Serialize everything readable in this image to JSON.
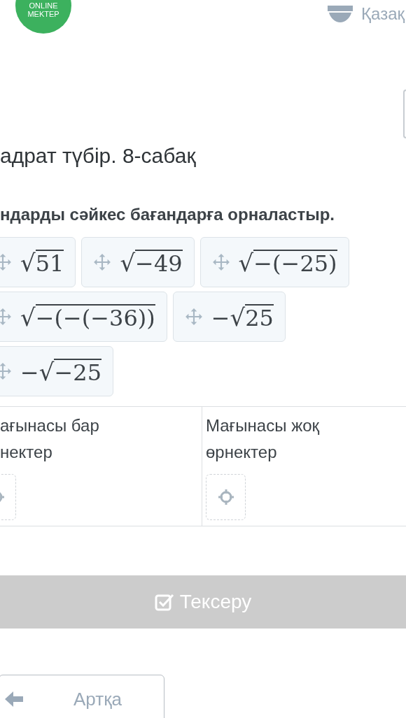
{
  "header": {
    "logo": [
      "ONLINE",
      "MEKTEP"
    ],
    "language": "Қазақ"
  },
  "title": "адрат түбір. 8-сабақ",
  "instruction": "ндарды сәйкес бағандарға орналастыр.",
  "tile_rows": [
    [
      {
        "radical": "√",
        "radicand": "51"
      },
      {
        "radical": "√",
        "radicand": "−49"
      },
      {
        "radical": "√",
        "radicand": "−(−25)"
      }
    ],
    [
      {
        "radical": "√",
        "radicand": "−(−(−36))"
      },
      {
        "prefix": "−",
        "radical": "√",
        "radicand": "25"
      }
    ],
    [
      {
        "prefix": "−",
        "radical": "√",
        "radicand": "−25"
      }
    ]
  ],
  "columns": [
    {
      "heading": "ағынасы бар\nнектер"
    },
    {
      "heading": "Мағынасы жоқ\nөрнектер"
    }
  ],
  "check_button": {
    "label": "Тексеру",
    "disabled": true
  },
  "back_button": {
    "label": "Артқа"
  }
}
